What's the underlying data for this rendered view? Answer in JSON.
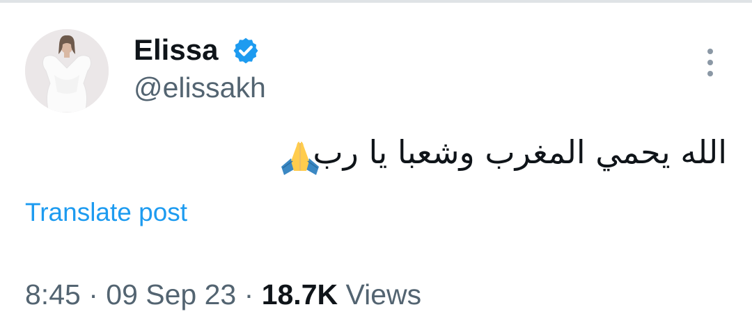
{
  "author": {
    "display_name": "Elissa",
    "handle": "@elissakh",
    "verified": true
  },
  "post": {
    "text": "الله يحمي المغرب وشعبا يا رب",
    "emoji": "folded-hands"
  },
  "translate_label": "Translate post",
  "meta": {
    "time": "8:45",
    "separator": "·",
    "date": "09 Sep 23",
    "views_count": "18.7K",
    "views_label": "Views"
  },
  "colors": {
    "link": "#1d9bf0",
    "secondary_text": "#536471",
    "badge": "#1d9bf0"
  }
}
